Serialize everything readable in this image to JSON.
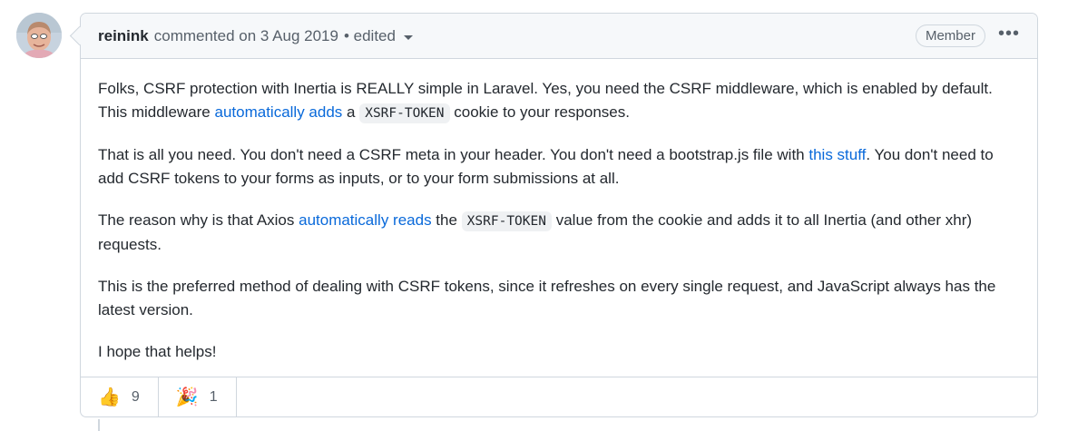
{
  "comment": {
    "author": "reinink",
    "meta": "commented on 3 Aug 2019",
    "edited_label": "• edited",
    "role_badge": "Member",
    "more_menu_icon": "kebab-horizontal-icon",
    "paragraphs": [
      {
        "t1": "Folks, CSRF protection with Inertia is REALLY simple in Laravel. Yes, you need the CSRF middleware, which is enabled by default. This middleware ",
        "link": "automatically adds",
        "t2": " a ",
        "code": "XSRF-TOKEN",
        "t3": " cookie to your responses."
      },
      {
        "t1": "That is all you need. You don't need a CSRF meta in your header. You don't need a bootstrap.js file with ",
        "link": "this stuff",
        "t2": ". You don't need to add CSRF tokens to your forms as inputs, or to your form submissions at all."
      },
      {
        "t1": "The reason why is that Axios ",
        "link": "automatically reads",
        "t2": " the ",
        "code": "XSRF-TOKEN",
        "t3": " value from the cookie and adds it to all Inertia (and other xhr) requests."
      },
      {
        "t1": "This is the preferred method of dealing with CSRF tokens, since it refreshes on every single request, and JavaScript always has the latest version."
      },
      {
        "t1": "I hope that helps!"
      }
    ],
    "reactions": [
      {
        "emoji": "👍",
        "icon": "thumbs-up-icon",
        "count": "9"
      },
      {
        "emoji": "🎉",
        "icon": "party-popper-icon",
        "count": "1"
      }
    ]
  },
  "colors": {
    "link": "#0969da",
    "border": "#d0d7de",
    "header_bg": "#f6f8fa",
    "text": "#24292f",
    "muted": "#57606a"
  }
}
